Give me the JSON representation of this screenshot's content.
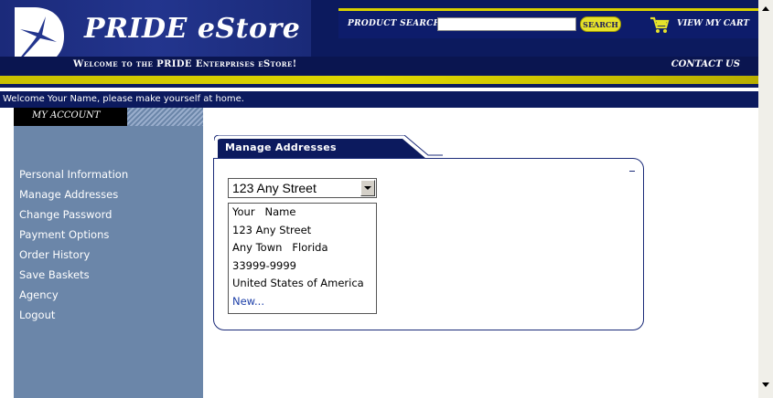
{
  "header": {
    "brand": "PRIDE eStore",
    "search_label": "PRODUCT SEARCH",
    "search_value": "",
    "search_button": "SEARCH",
    "cart_label": "VIEW MY CART",
    "welcome_band": "Welcome to the PRIDE Enterprises eStore!",
    "contact_link": "CONTACT US"
  },
  "greeting": "Welcome Your Name, please make yourself at home.",
  "sidebar": {
    "heading": "MY ACCOUNT",
    "items": [
      {
        "label": "Personal Information"
      },
      {
        "label": "Manage Addresses"
      },
      {
        "label": "Change Password"
      },
      {
        "label": "Payment Options"
      },
      {
        "label": "Order History"
      },
      {
        "label": "Save Baskets"
      },
      {
        "label": "Agency"
      },
      {
        "label": "Logout"
      }
    ]
  },
  "panel": {
    "title": "Manage Addresses",
    "selected_address": "123 Any Street",
    "address_lines": [
      "Your   Name",
      "123 Any Street",
      "Any Town   Florida",
      "33999-9999",
      "United States of America"
    ],
    "new_link": "New..."
  },
  "colors": {
    "header_navy": "#0c1a5e",
    "accent_yellow": "#e0d800",
    "sidebar_blue": "#6b86a9",
    "link_blue": "#1d3fa8"
  },
  "icons": [
    "logo-mark-icon",
    "cart-icon",
    "dropdown-arrow-icon",
    "scroll-up-icon",
    "scroll-down-icon"
  ]
}
